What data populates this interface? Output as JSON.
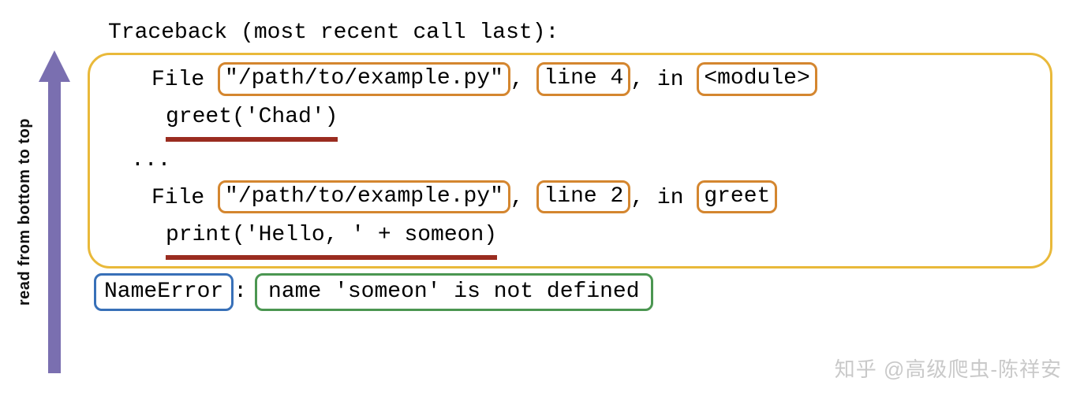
{
  "arrow": {
    "label": "read from bottom to top",
    "color": "#7a6fb0"
  },
  "traceback": {
    "header": "Traceback (most recent call last):",
    "frames": [
      {
        "prefix": "File ",
        "path": "\"/path/to/example.py\"",
        "sep1": ", ",
        "line": "line 4",
        "sep2": ", in ",
        "scope": "<module>",
        "code": "greet('Chad')"
      },
      {
        "prefix": "File ",
        "path": "\"/path/to/example.py\"",
        "sep1": ", ",
        "line": "line 2",
        "sep2": ", in ",
        "scope": "greet",
        "code": "print('Hello, ' + someon)"
      }
    ],
    "ellipsis": "..."
  },
  "error": {
    "type": "NameError",
    "colon": ": ",
    "message": "name 'someon' is not defined"
  },
  "colors": {
    "frame_box": "#e9b93a",
    "token_box": "#d4862f",
    "underline": "#9a2c20",
    "error_type_box": "#3870b8",
    "error_msg_box": "#4b9651"
  },
  "watermark": "知乎 @高级爬虫-陈祥安"
}
